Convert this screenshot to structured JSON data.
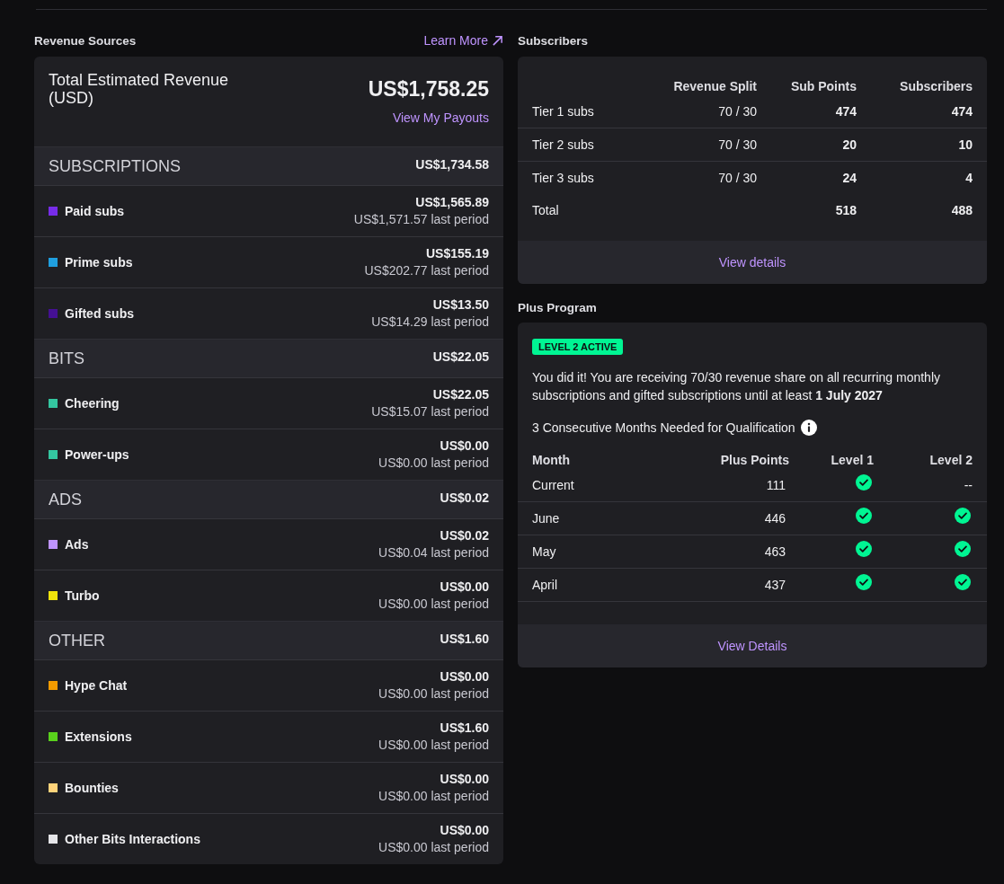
{
  "revenue_sources": {
    "title": "Revenue Sources",
    "learn_more": "Learn More",
    "total_label": "Total Estimated Revenue (USD)",
    "total": "US$1,758.25",
    "payouts_link": "View My Payouts",
    "sections": [
      {
        "name": "SUBSCRIPTIONS",
        "amount": "US$1,734.58",
        "items": [
          {
            "name": "Paid subs",
            "color": "#772ce8",
            "amount": "US$1,565.89",
            "previous": "US$1,571.57 last period"
          },
          {
            "name": "Prime subs",
            "color": "#1f9fdf",
            "amount": "US$155.19",
            "previous": "US$202.77 last period"
          },
          {
            "name": "Gifted subs",
            "color": "#451093",
            "amount": "US$13.50",
            "previous": "US$14.29 last period"
          }
        ]
      },
      {
        "name": "BITS",
        "amount": "US$22.05",
        "items": [
          {
            "name": "Cheering",
            "color": "#34c6a0",
            "amount": "US$22.05",
            "previous": "US$15.07 last period"
          },
          {
            "name": "Power-ups",
            "color": "#34c6a0",
            "amount": "US$0.00",
            "previous": "US$0.00 last period"
          }
        ]
      },
      {
        "name": "ADS",
        "amount": "US$0.02",
        "items": [
          {
            "name": "Ads",
            "color": "#bf94ff",
            "amount": "US$0.02",
            "previous": "US$0.04 last period"
          },
          {
            "name": "Turbo",
            "color": "#f2e50c",
            "amount": "US$0.00",
            "previous": "US$0.00 last period"
          }
        ]
      },
      {
        "name": "OTHER",
        "amount": "US$1.60",
        "items": [
          {
            "name": "Hype Chat",
            "color": "#f29b00",
            "amount": "US$0.00",
            "previous": "US$0.00 last period"
          },
          {
            "name": "Extensions",
            "color": "#59d11c",
            "amount": "US$1.60",
            "previous": "US$0.00 last period"
          },
          {
            "name": "Bounties",
            "color": "#ffd37a",
            "amount": "US$0.00",
            "previous": "US$0.00 last period"
          },
          {
            "name": "Other Bits Interactions",
            "color": "#e5e5e8",
            "amount": "US$0.00",
            "previous": "US$0.00 last period"
          }
        ]
      }
    ]
  },
  "subscribers": {
    "title": "Subscribers",
    "columns": [
      "Revenue Split",
      "Sub Points",
      "Subscribers"
    ],
    "rows": [
      {
        "label": "Tier 1 subs",
        "split": "70 / 30",
        "points": "474",
        "subscribers": "474"
      },
      {
        "label": "Tier 2 subs",
        "split": "70 / 30",
        "points": "20",
        "subscribers": "10"
      },
      {
        "label": "Tier 3 subs",
        "split": "70 / 30",
        "points": "24",
        "subscribers": "4"
      }
    ],
    "total": {
      "label": "Total",
      "points": "518",
      "subscribers": "488"
    },
    "details_button": "View details"
  },
  "plus_program": {
    "title": "Plus Program",
    "badge": "LEVEL 2 ACTIVE",
    "message": "You did it! You are receiving 70/30 revenue share on all recurring monthly subscriptions and gifted subscriptions until at least **1 July 2027**",
    "requirement": "3 Consecutive Months Needed for Qualification",
    "columns": [
      "Month",
      "Plus Points",
      "Level 1",
      "Level 2"
    ],
    "rows": [
      {
        "month": "Current",
        "points": "111",
        "levels": [
          {
            "kind": "check"
          },
          {
            "kind": "text",
            "text": "--"
          }
        ]
      },
      {
        "month": "June",
        "points": "446",
        "levels": [
          {
            "kind": "check"
          },
          {
            "kind": "check"
          }
        ]
      },
      {
        "month": "May",
        "points": "463",
        "levels": [
          {
            "kind": "check"
          },
          {
            "kind": "check"
          }
        ]
      },
      {
        "month": "April",
        "points": "437",
        "levels": [
          {
            "kind": "check"
          },
          {
            "kind": "check"
          }
        ]
      }
    ],
    "details_button": "View Details"
  }
}
